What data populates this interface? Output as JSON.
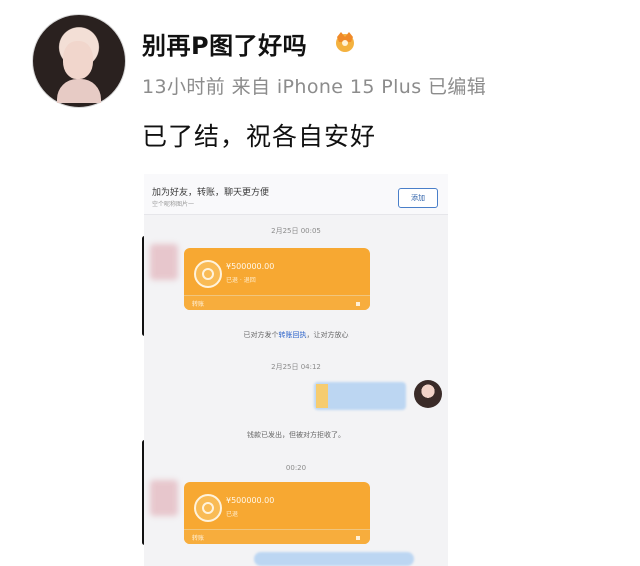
{
  "post": {
    "author_name": "别再P图了好吗",
    "badge_icon": "crown-icon",
    "meta": "13小时前  来自 iPhone 15 Plus 已编辑",
    "text": "已了结，祝各自安好"
  },
  "chat_screenshot": {
    "header_title": "加为好友，转账，聊天更方便",
    "header_sub": "空个昵称图片一",
    "header_button": "添加",
    "time_1": "2月25日 00:05",
    "transfer_1": {
      "amount": "¥500000.00",
      "status": "已退 · 退回",
      "label": "转账"
    },
    "note_prefix": "已对方发个",
    "note_link": "转账回执",
    "note_suffix": "，让对方放心",
    "time_2": "2月25日 04:12",
    "message_center": "钱款已发出，但被对方拒收了。",
    "time_3": "00:20",
    "transfer_2": {
      "amount": "¥500000.00",
      "status": "已退",
      "label": "转账"
    }
  },
  "colors": {
    "transfer_orange": "#f7a832",
    "link_blue": "#2b62c9",
    "meta_gray": "#8c8c8c"
  }
}
